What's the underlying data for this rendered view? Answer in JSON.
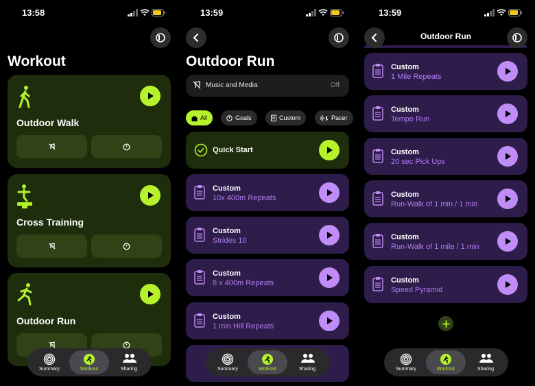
{
  "colors": {
    "accent_green": "#b6f22b",
    "accent_purple": "#c08cf7",
    "purple_text": "#b07cf2"
  },
  "screen1": {
    "time": "13:58",
    "title": "Workout",
    "cards": [
      {
        "title": "Outdoor Walk",
        "icon": "walking-figure-icon"
      },
      {
        "title": "Cross Training",
        "icon": "cross-training-figure-icon"
      },
      {
        "title": "Outdoor Run",
        "icon": "running-figure-icon"
      }
    ]
  },
  "screen2": {
    "time": "13:59",
    "title": "Outdoor Run",
    "music": {
      "label": "Music and Media",
      "value": "Off"
    },
    "chips": [
      "All",
      "Goals",
      "Custom",
      "Pacer"
    ],
    "quick_start": "Quick Start",
    "items": [
      {
        "title": "Custom",
        "subtitle": "10x 400m Repeats"
      },
      {
        "title": "Custom",
        "subtitle": "Strides 10"
      },
      {
        "title": "Custom",
        "subtitle": "8 x 400m Repeats"
      },
      {
        "title": "Custom",
        "subtitle": "1 min Hill Repeats"
      }
    ]
  },
  "screen3": {
    "time": "13:59",
    "nav_title": "Outdoor Run",
    "items": [
      {
        "title": "Custom",
        "subtitle": "1 Mile Repeats"
      },
      {
        "title": "Custom",
        "subtitle": "Tempo Run"
      },
      {
        "title": "Custom",
        "subtitle": "20 sec Pick Ups"
      },
      {
        "title": "Custom",
        "subtitle": "Run-Walk of 1 min / 1 min"
      },
      {
        "title": "Custom",
        "subtitle": "Run-Walk of 1 mile / 1 min"
      },
      {
        "title": "Custom",
        "subtitle": "Speed Pyramid"
      }
    ]
  },
  "tabs": [
    "Summary",
    "Workout",
    "Sharing"
  ]
}
